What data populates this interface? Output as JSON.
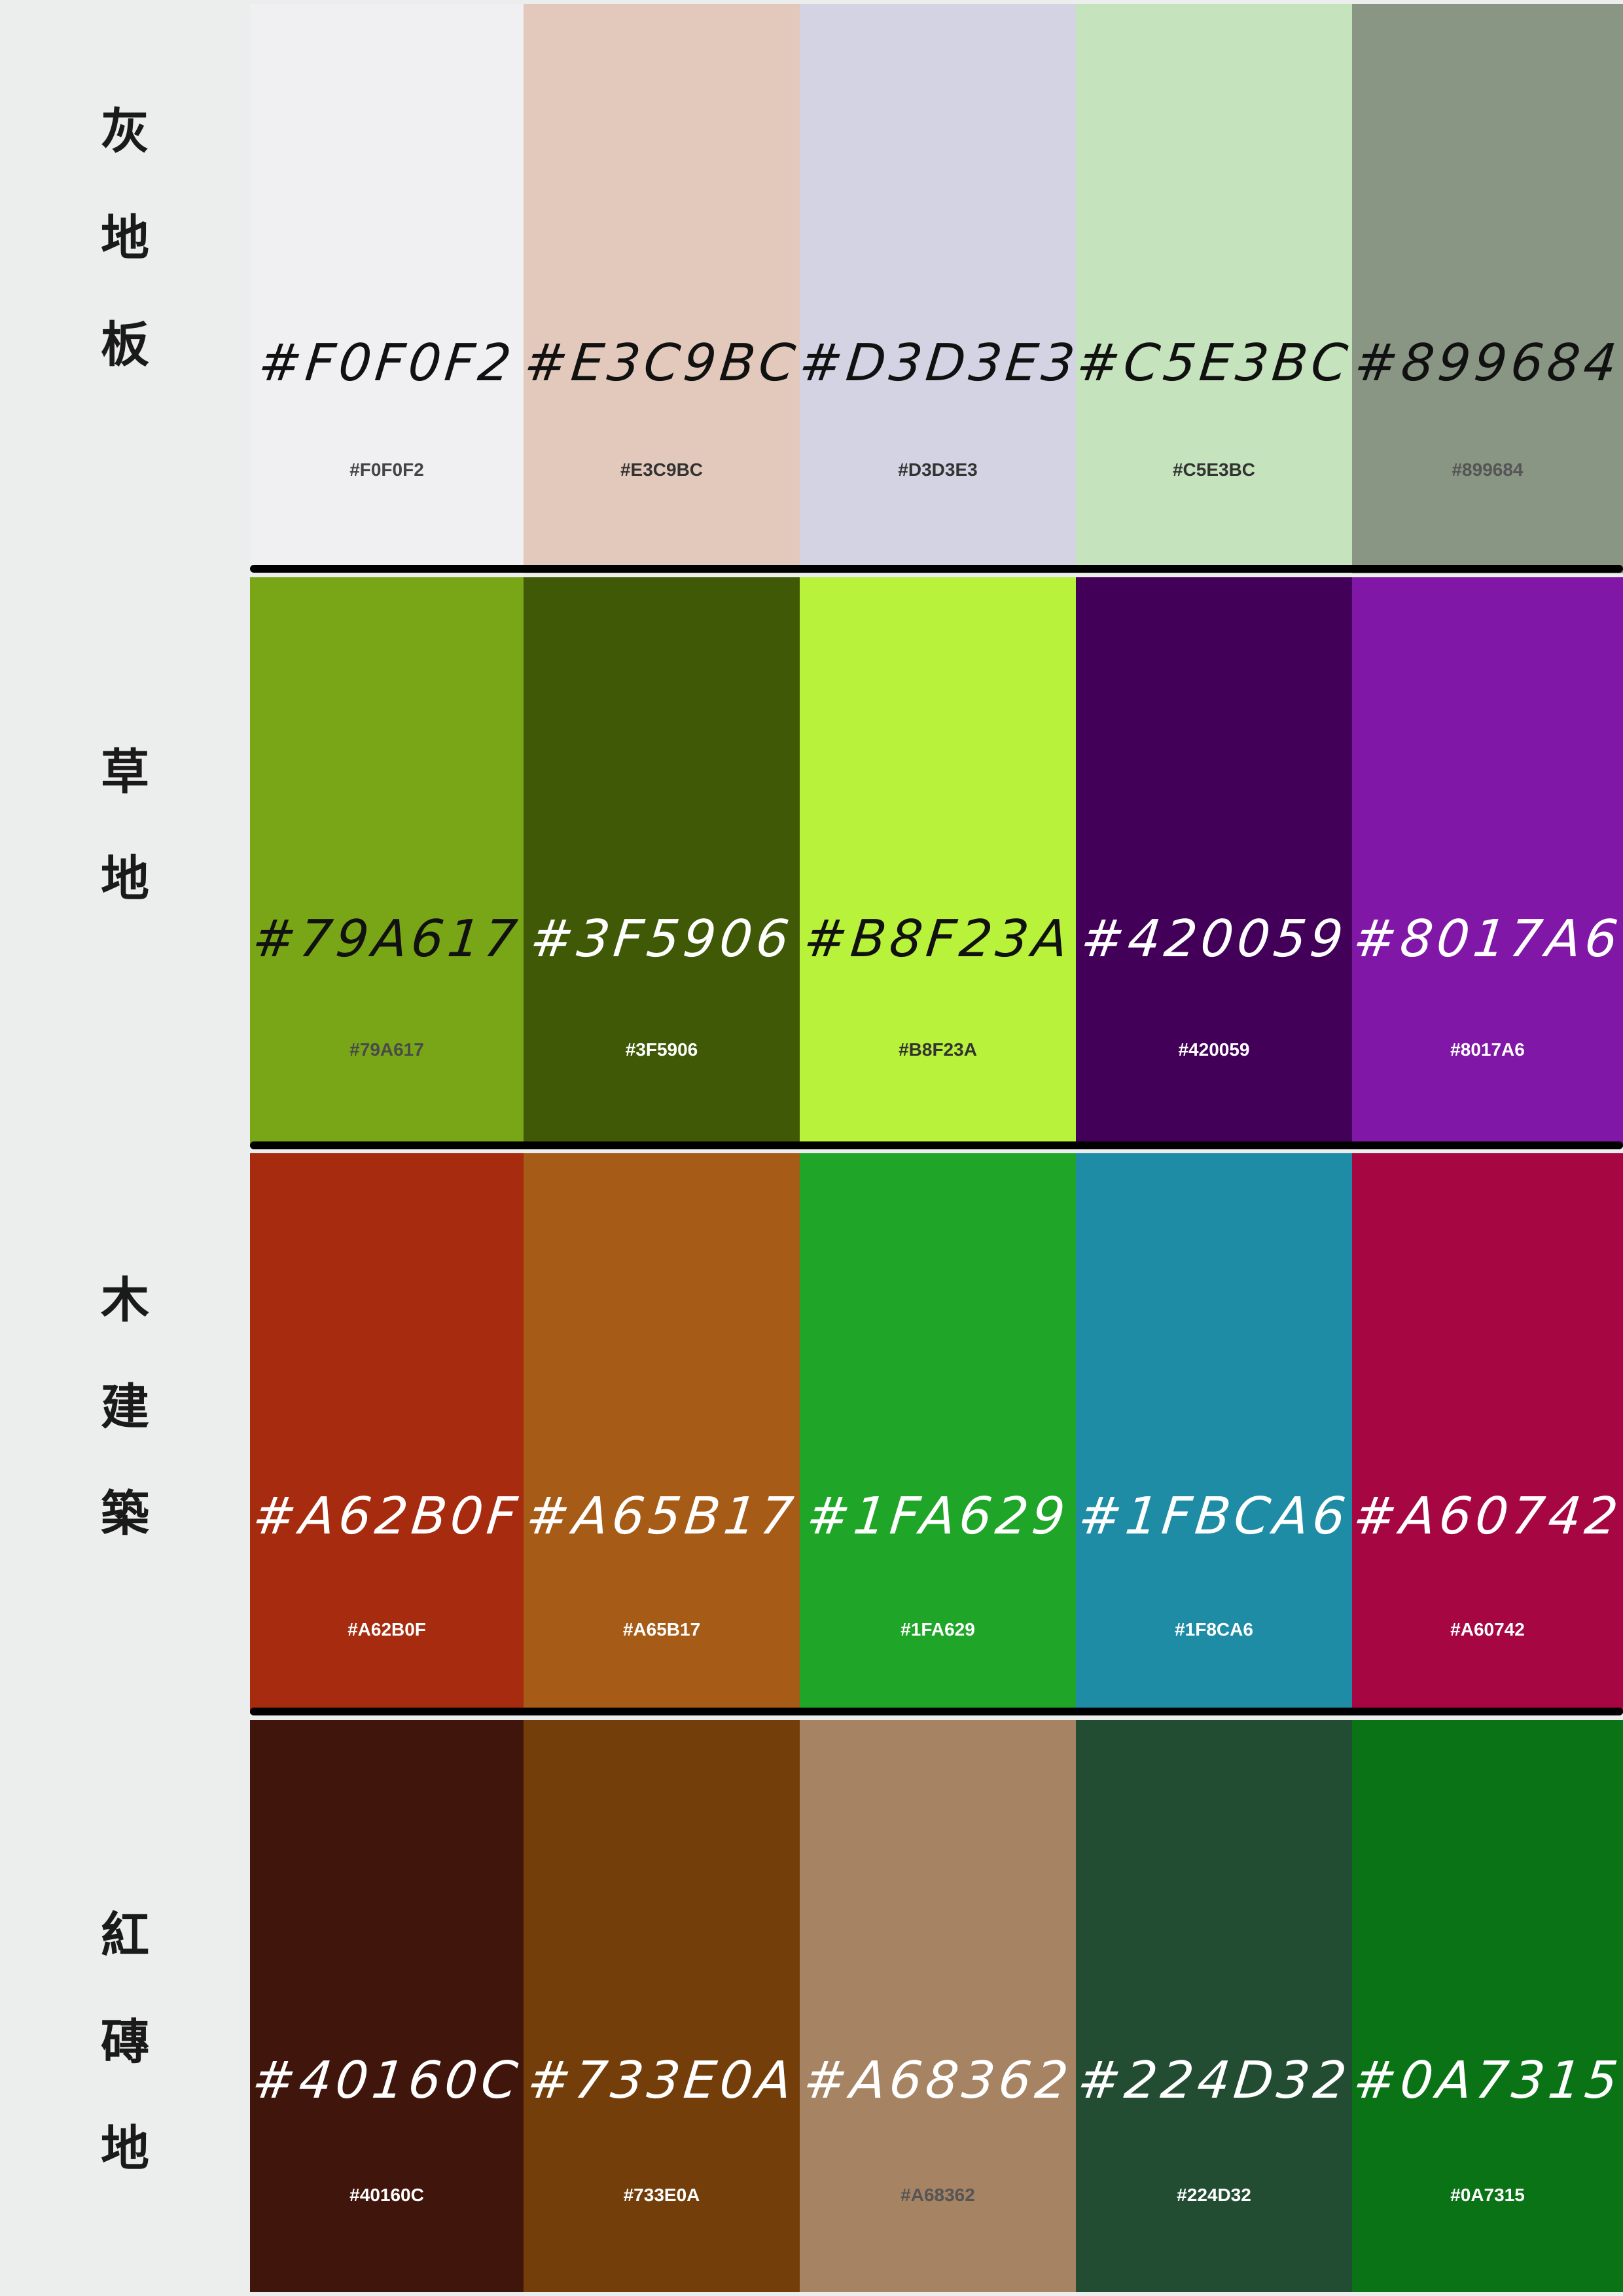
{
  "rows": [
    {
      "label": [
        "灰",
        "地",
        "板"
      ],
      "swatches": [
        {
          "hex": "#F0F0F2",
          "hand": "#F0F0F2",
          "code": "#F0F0F2",
          "hand_color": "#111111",
          "code_color": "#444444"
        },
        {
          "hex": "#E3C9BC",
          "hand": "#E3C9BC",
          "code": "#E3C9BC",
          "hand_color": "#111111",
          "code_color": "#333333"
        },
        {
          "hex": "#D3D3E3",
          "hand": "#D3D3E3",
          "code": "#D3D3E3",
          "hand_color": "#111111",
          "code_color": "#333333"
        },
        {
          "hex": "#C5E3BC",
          "hand": "#C5E3BC",
          "code": "#C5E3BC",
          "hand_color": "#111111",
          "code_color": "#333333"
        },
        {
          "hex": "#899684",
          "hand": "#899684",
          "code": "#899684",
          "hand_color": "#111111",
          "code_color": "#555555"
        }
      ]
    },
    {
      "label": [
        "草",
        "地"
      ],
      "swatches": [
        {
          "hex": "#79A617",
          "hand": "#79A617",
          "code": "#79A617",
          "hand_color": "#111111",
          "code_color": "#4a4a4a"
        },
        {
          "hex": "#3F5906",
          "hand": "#3F5906",
          "code": "#3F5906",
          "hand_color": "#ffffff",
          "code_color": "#ffffff"
        },
        {
          "hex": "#B8F23A",
          "hand": "#B8F23A",
          "code": "#B8F23A",
          "hand_color": "#111111",
          "code_color": "#333333"
        },
        {
          "hex": "#420059",
          "hand": "#420059",
          "code": "#420059",
          "hand_color": "#ffffff",
          "code_color": "#ffffff"
        },
        {
          "hex": "#8017A6",
          "hand": "#8017A6",
          "code": "#8017A6",
          "hand_color": "#ffffff",
          "code_color": "#ffffff"
        }
      ]
    },
    {
      "label": [
        "木",
        "建",
        "築"
      ],
      "swatches": [
        {
          "hex": "#A62B0F",
          "hand": "#A62B0F",
          "code": "#A62B0F",
          "hand_color": "#ffffff",
          "code_color": "#ffffff"
        },
        {
          "hex": "#A65B17",
          "hand": "#A65B17",
          "code": "#A65B17",
          "hand_color": "#ffffff",
          "code_color": "#ffffff"
        },
        {
          "hex": "#1FA629",
          "hand": "#1FA629",
          "code": "#1FA629",
          "hand_color": "#ffffff",
          "code_color": "#ffffff"
        },
        {
          "hex": "#1F8CA6",
          "hand": "#1FBCA6",
          "code": "#1F8CA6",
          "hand_color": "#ffffff",
          "code_color": "#ffffff"
        },
        {
          "hex": "#A60742",
          "hand": "#A60742",
          "code": "#A60742",
          "hand_color": "#ffffff",
          "code_color": "#ffffff"
        }
      ]
    },
    {
      "label": [
        "紅",
        "磚",
        "地"
      ],
      "swatches": [
        {
          "hex": "#40160C",
          "hand": "#40160C",
          "code": "#40160C",
          "hand_color": "#ffffff",
          "code_color": "#ffffff"
        },
        {
          "hex": "#733E0A",
          "hand": "#733E0A",
          "code": "#733E0A",
          "hand_color": "#ffffff",
          "code_color": "#ffffff"
        },
        {
          "hex": "#A68362",
          "hand": "#A68362",
          "code": "#A68362",
          "hand_color": "#ffffff",
          "code_color": "#555555"
        },
        {
          "hex": "#224D32",
          "hand": "#224D32",
          "code": "#224D32",
          "hand_color": "#ffffff",
          "code_color": "#ffffff"
        },
        {
          "hex": "#0A7315",
          "hand": "#0A7315",
          "code": "#0A7315",
          "hand_color": "#ffffff",
          "code_color": "#ffffff"
        }
      ]
    }
  ]
}
